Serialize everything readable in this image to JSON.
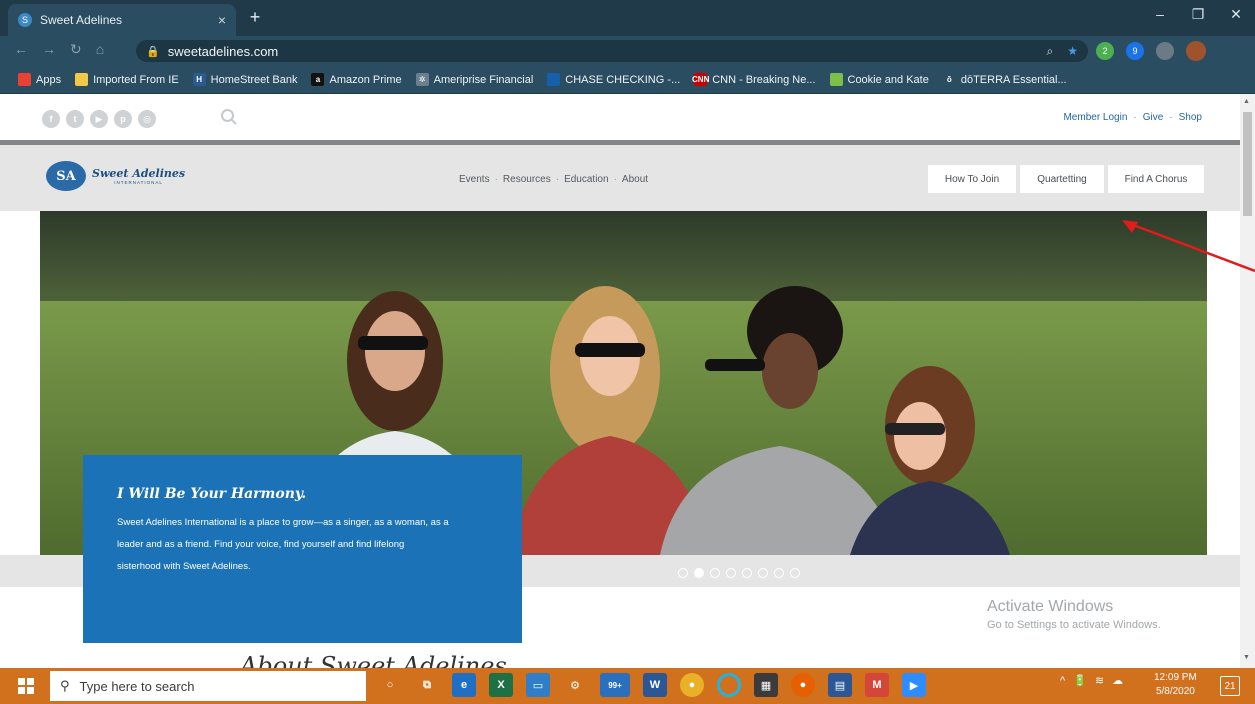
{
  "browser": {
    "tab_title": "Sweet Adelines",
    "tab_close": "×",
    "new_tab": "+",
    "url": "sweetadelines.com",
    "window_controls": {
      "minimize": "–",
      "restore": "❐",
      "close": "✕"
    },
    "nav": {
      "back": "←",
      "forward": "→",
      "reload": "↻",
      "home": "⌂"
    },
    "ext_badges": {
      "ext2": "2",
      "ext9": "9"
    }
  },
  "bookmarks": [
    {
      "label": "Apps",
      "icon": "apps-grid-icon",
      "color": "#e94235"
    },
    {
      "label": "Imported From IE",
      "icon": "folder-icon",
      "color": "#f2c84b"
    },
    {
      "label": "HomeStreet Bank",
      "icon": "homestreet-icon",
      "color": "#2b5b8e",
      "glyph": "H"
    },
    {
      "label": "Amazon Prime",
      "icon": "amazon-icon",
      "color": "#111111",
      "glyph": "a"
    },
    {
      "label": "Ameriprise Financial",
      "icon": "ameriprise-icon",
      "color": "#6b7f8e",
      "glyph": "✲"
    },
    {
      "label": "CHASE CHECKING -...",
      "icon": "chase-icon",
      "color": "#1460aa",
      "glyph": ""
    },
    {
      "label": "CNN - Breaking Ne...",
      "icon": "cnn-icon",
      "color": "#cc0000",
      "glyph": "CNN"
    },
    {
      "label": "Cookie and Kate",
      "icon": "cookie-kate-icon",
      "color": "#7cbf4a",
      "glyph": ""
    },
    {
      "label": "dōTERRA Essential...",
      "icon": "doterra-icon",
      "color": "#2b4d61",
      "glyph": "ō"
    }
  ],
  "site": {
    "social_icons": [
      "facebook-icon",
      "twitter-icon",
      "youtube-icon",
      "pinterest-icon",
      "instagram-icon"
    ],
    "utility_links": {
      "member_login": "Member Login",
      "give": "Give",
      "shop": "Shop",
      "sep": "·"
    },
    "logo": {
      "name": "Sweet Adelines",
      "sub": "INTERNATIONAL",
      "badge": "SA"
    },
    "main_nav": {
      "events": "Events",
      "resources": "Resources",
      "education": "Education",
      "about": "About",
      "sep": "·"
    },
    "cta_buttons": {
      "how_to_join": "How To Join",
      "quartetting": "Quartetting",
      "find_chorus": "Find A Chorus"
    },
    "hero": {
      "slides": 8,
      "active_slide": 2,
      "callout_title": "I Will Be Your Harmony.",
      "callout_line1": "Sweet Adelines International is a place to grow—as a singer, as a woman, as a",
      "callout_line2": "leader and as a friend. Find your voice, find yourself and find lifelong",
      "callout_line3": "sisterhood with Sweet Adelines."
    },
    "below_fold_heading": "About Sweet Adelines",
    "activate_windows": {
      "title": "Activate Windows",
      "subtitle": "Go to Settings to activate Windows."
    }
  },
  "taskbar": {
    "search_placeholder": "Type here to search",
    "mail_badge": "99+",
    "tray": {
      "chevron": "^",
      "battery": "🔋",
      "wifi": "≋",
      "cloud": "☁"
    },
    "clock_time": "12:09 PM",
    "clock_date": "5/8/2020",
    "notifications": "21"
  },
  "colors": {
    "accent_blue": "#1b72b6",
    "link_blue": "#2566a6",
    "taskbar": "#d1711d",
    "chrome": "#2b4d61",
    "annotation_red": "#e21b1b"
  }
}
